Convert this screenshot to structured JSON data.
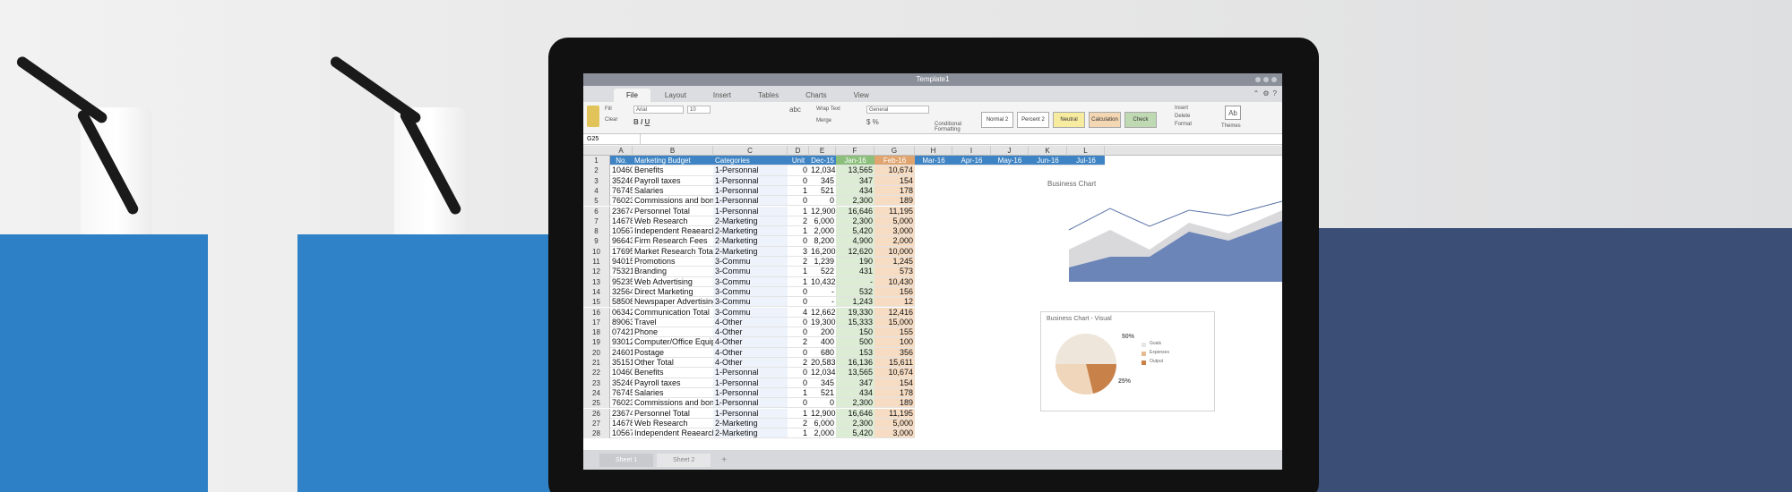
{
  "window": {
    "title": "Template1"
  },
  "menu_tabs": [
    "File",
    "Layout",
    "Insert",
    "Tables",
    "Charts",
    "View"
  ],
  "ribbon": {
    "font_name": "Arial",
    "font_size": "10",
    "number_format": "General",
    "style_boxes": [
      "Normal 2",
      "Percent 2",
      "Neutral",
      "Calculation",
      "Check"
    ],
    "labels": {
      "fill": "Fill",
      "clear": "Clear",
      "wrap_text": "Wrap Text",
      "merge": "Merge",
      "conditional_formatting": "Conditional Formatting",
      "insert": "Insert",
      "delete": "Delete",
      "format": "Format",
      "themes": "Themes",
      "abc": "abc"
    }
  },
  "formula_bar": {
    "cell_ref": "G25"
  },
  "spreadsheet": {
    "column_letters": [
      "A",
      "B",
      "C",
      "D",
      "E",
      "F",
      "G",
      "H",
      "I",
      "J",
      "K",
      "L"
    ],
    "header_row": [
      "No.",
      "Marketing Budget",
      "Categories",
      "Unit",
      "Dec-15",
      "Jan-16",
      "Feb-16",
      "Mar-16",
      "Apr-16",
      "May-16",
      "Jun-16",
      "Jul-16"
    ],
    "rows": [
      [
        "10460",
        "Benefits",
        "1-Personnal",
        "0",
        "12,034",
        "13,565",
        "10,674"
      ],
      [
        "35246",
        "Payroll taxes",
        "1-Personnal",
        "0",
        "345",
        "347",
        "154"
      ],
      [
        "76745",
        "Salaries",
        "1-Personnal",
        "1",
        "521",
        "434",
        "178"
      ],
      [
        "76023",
        "Commissions and bonuses",
        "1-Personnal",
        "0",
        "0",
        "2,300",
        "189"
      ],
      [
        "23674",
        "Personnel Total",
        "1-Personnal",
        "1",
        "12,900",
        "16,646",
        "11,195"
      ],
      [
        "14678",
        "Web Research",
        "2-Marketing",
        "2",
        "6,000",
        "2,300",
        "5,000"
      ],
      [
        "10567",
        "Independent Reaearch",
        "2-Marketing",
        "1",
        "2,000",
        "5,420",
        "3,000"
      ],
      [
        "96643",
        "Firm Research Fees",
        "2-Marketing",
        "0",
        "8,200",
        "4,900",
        "2,000"
      ],
      [
        "17695",
        "Market Research Total",
        "2-Marketing",
        "3",
        "16,200",
        "12,620",
        "10,000"
      ],
      [
        "94015",
        "Promotions",
        "3-Commu",
        "2",
        "1,239",
        "190",
        "1,245"
      ],
      [
        "75321",
        "Branding",
        "3-Commu",
        "1",
        "522",
        "431",
        "573"
      ],
      [
        "95235",
        "Web Advertising",
        "3-Commu",
        "1",
        "10,432",
        "-",
        "10,430"
      ],
      [
        "32564",
        "Direct Marketing",
        "3-Commu",
        "0",
        "-",
        "532",
        "156"
      ],
      [
        "58508",
        "Newspaper Advertising",
        "3-Commu",
        "0",
        "-",
        "1,243",
        "12"
      ],
      [
        "06342",
        "Communication Total",
        "3-Commu",
        "4",
        "12,662",
        "19,330",
        "12,416"
      ],
      [
        "89063",
        "Travel",
        "4-Other",
        "0",
        "19,300",
        "15,333",
        "15,000"
      ],
      [
        "07421",
        "Phone",
        "4-Other",
        "0",
        "200",
        "150",
        "155"
      ],
      [
        "93012",
        "Computer/Office Equipment",
        "4-Other",
        "2",
        "400",
        "500",
        "100"
      ],
      [
        "24601",
        "Postage",
        "4-Other",
        "0",
        "680",
        "153",
        "356"
      ],
      [
        "35151",
        "Other Total",
        "4-Other",
        "2",
        "20,583",
        "16,136",
        "15,611"
      ],
      [
        "10460",
        "Benefits",
        "1-Personnal",
        "0",
        "12,034",
        "13,565",
        "10,674"
      ],
      [
        "35246",
        "Payroll taxes",
        "1-Personnal",
        "0",
        "345",
        "347",
        "154"
      ],
      [
        "76745",
        "Salaries",
        "1-Personnal",
        "1",
        "521",
        "434",
        "178"
      ],
      [
        "76023",
        "Commissions and bonuses",
        "1-Personnal",
        "0",
        "0",
        "2,300",
        "189"
      ],
      [
        "23674",
        "Personnel Total",
        "1-Personnal",
        "1",
        "12,900",
        "16,646",
        "11,195"
      ],
      [
        "14678",
        "Web Research",
        "2-Marketing",
        "2",
        "6,000",
        "2,300",
        "5,000"
      ],
      [
        "10567",
        "Independent Reaearch",
        "2-Marketing",
        "1",
        "2,000",
        "5,420",
        "3,000"
      ]
    ]
  },
  "chart1": {
    "title": "Business Chart"
  },
  "chart2": {
    "title": "Business Chart - Visual",
    "pct_large": "50%",
    "pct_small": "25%",
    "legend": [
      "Goals",
      "Expenses",
      "Output"
    ]
  },
  "sheets": [
    "Sheet 1",
    "Sheet 2"
  ],
  "add_sheet": "+",
  "colors": {
    "header_blue": "#3e84c4",
    "jan_green": "#dcecd5",
    "feb_orange": "#f6dcc3",
    "wall_navy": "#3a4e76",
    "box_blue": "#2d7fc6"
  }
}
